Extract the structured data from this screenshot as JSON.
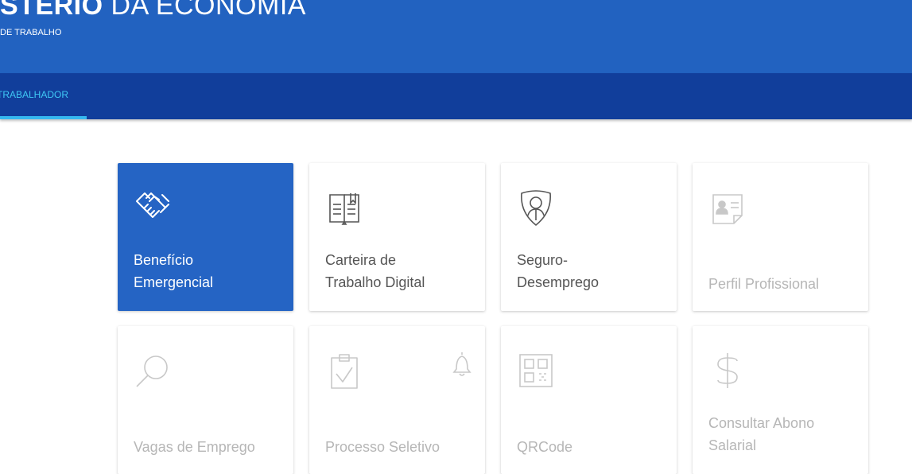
{
  "header": {
    "title_bold": "STÉRIO",
    "title_rest": " DA ECONOMIA",
    "subtitle": "DE TRABALHO"
  },
  "nav": {
    "tab": "TRABALHADOR"
  },
  "cards": [
    {
      "label": "Benefício\nEmergencial",
      "icon": "handshake-icon",
      "state": "active"
    },
    {
      "label": "Carteira de\nTrabalho Digital",
      "icon": "work-card-book-icon",
      "state": "enabled"
    },
    {
      "label": "Seguro-\nDesemprego",
      "icon": "shield-person-icon",
      "state": "enabled"
    },
    {
      "label": "Perfil Profissional",
      "icon": "profile-card-icon",
      "state": "disabled"
    },
    {
      "label": "Vagas de Emprego",
      "icon": "magnifier-icon",
      "state": "disabled"
    },
    {
      "label": "Processo Seletivo",
      "icon": "clipboard-check-icon",
      "state": "disabled",
      "extra_icon": "bell-icon"
    },
    {
      "label": "QRCode",
      "icon": "qrcode-icon",
      "state": "disabled"
    },
    {
      "label": "Consultar Abono\nSalarial",
      "icon": "dollar-icon",
      "state": "disabled"
    }
  ],
  "colors": {
    "header": "#2262c0",
    "navbar": "#113e9b",
    "nav_accent": "#35b8f0",
    "active_card": "#2564c4",
    "enabled_icon": "#555555",
    "disabled_icon": "#c8c8c8"
  }
}
